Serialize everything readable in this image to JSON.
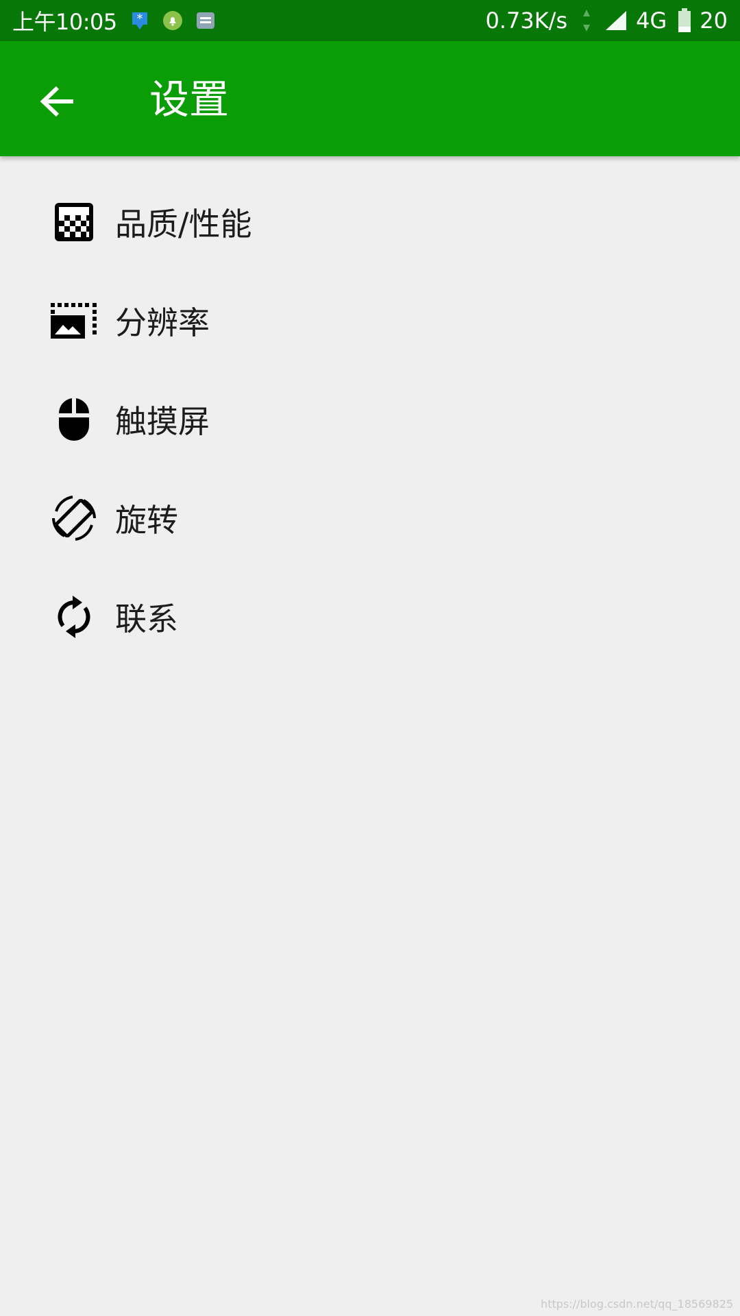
{
  "status_bar": {
    "time": "上午10:05",
    "net_speed": "0.73K/s",
    "net_type": "4G",
    "battery": "20",
    "notification_icons": [
      "bluetooth-star-icon",
      "bell-icon",
      "message-icon"
    ]
  },
  "app_bar": {
    "title": "设置",
    "back_icon": "arrow-left-icon",
    "color": "#0b9d05"
  },
  "settings": {
    "items": [
      {
        "label": "品质/性能",
        "icon": "quality-checker-icon"
      },
      {
        "label": "分辨率",
        "icon": "resolution-icon"
      },
      {
        "label": "触摸屏",
        "icon": "mouse-icon"
      },
      {
        "label": "旋转",
        "icon": "screen-rotation-icon"
      },
      {
        "label": "联系",
        "icon": "sync-icon"
      }
    ]
  },
  "watermark": "https://blog.csdn.net/qq_18569825",
  "colors": {
    "status_bar": "#077707",
    "background": "#efeff0"
  }
}
